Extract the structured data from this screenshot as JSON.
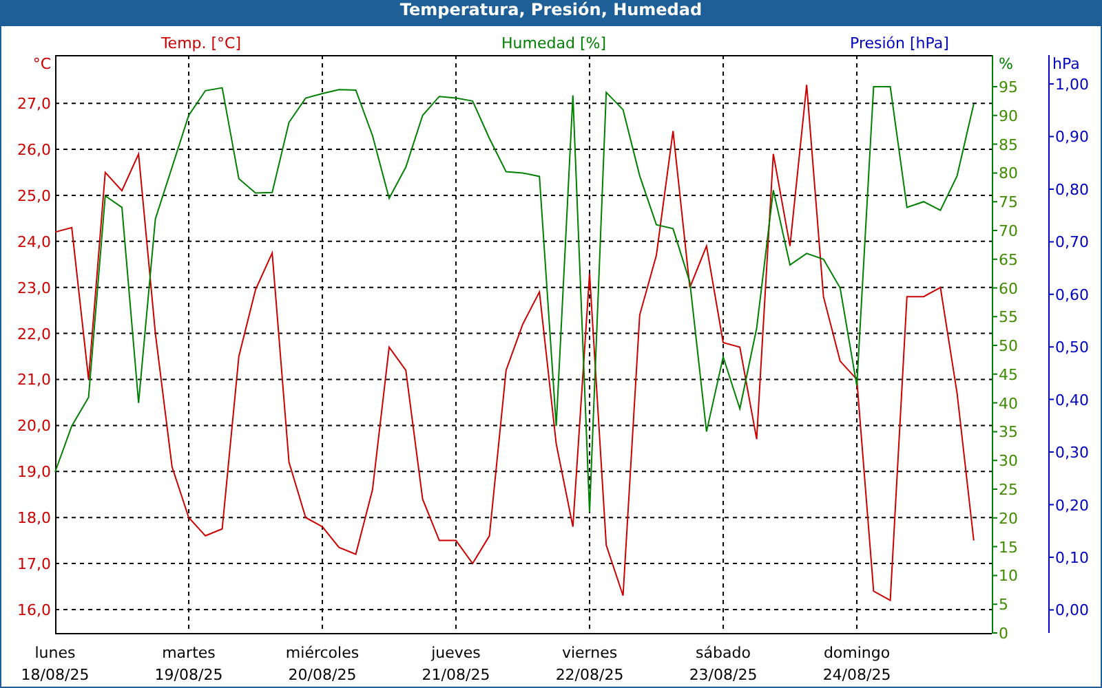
{
  "window": {
    "title": "Temperatura, Presión, Humedad"
  },
  "chart_data": {
    "type": "line",
    "grid": true,
    "categories": [
      "lunes\n18/08/25",
      null,
      null,
      null,
      null,
      null,
      null,
      null,
      "martes\n19/08/25",
      null,
      null,
      null,
      null,
      null,
      null,
      null,
      "miércoles\n20/08/25",
      null,
      null,
      null,
      null,
      null,
      null,
      null,
      "jueves\n21/08/25",
      null,
      null,
      null,
      null,
      null,
      null,
      null,
      "viernes\n22/08/25",
      null,
      null,
      null,
      null,
      null,
      null,
      null,
      "sábado\n23/08/25",
      null,
      null,
      null,
      null,
      null,
      null,
      null,
      "domingo\n24/08/25",
      null,
      null,
      null,
      null,
      null,
      null,
      null
    ],
    "ylabel": "°C",
    "ylim": [
      15.49,
      28.05
    ],
    "yticks": [
      {
        "value": 16,
        "label": "16,0"
      },
      {
        "value": 17,
        "label": "17,0"
      },
      {
        "value": 18,
        "label": "18,0"
      },
      {
        "value": 19,
        "label": "19,0"
      },
      {
        "value": 20,
        "label": "20,0"
      },
      {
        "value": 21,
        "label": "21,0"
      },
      {
        "value": 22,
        "label": "22,0"
      },
      {
        "value": 23,
        "label": "23,0"
      },
      {
        "value": 24,
        "label": "24,0"
      },
      {
        "value": 25,
        "label": "25,0"
      },
      {
        "value": 26,
        "label": "26,0"
      },
      {
        "value": 27,
        "label": "27,0"
      }
    ],
    "y2label": "%",
    "y2lim": [
      0,
      100.5
    ],
    "y2ticks": [
      0,
      5,
      10,
      15,
      20,
      25,
      30,
      35,
      40,
      45,
      50,
      55,
      60,
      65,
      70,
      75,
      80,
      85,
      90,
      95
    ],
    "y3label": "hPa",
    "y3lim": [
      -0.044,
      1.055
    ],
    "y3ticks": [
      {
        "value": 0,
        "label": "0,00"
      },
      {
        "value": 0.1,
        "label": "0,10"
      },
      {
        "value": 0.2,
        "label": "0,20"
      },
      {
        "value": 0.3,
        "label": "0,30"
      },
      {
        "value": 0.4,
        "label": "0,40"
      },
      {
        "value": 0.5,
        "label": "0,50"
      },
      {
        "value": 0.6,
        "label": "0,60"
      },
      {
        "value": 0.7,
        "label": "0,70"
      },
      {
        "value": 0.8,
        "label": "0,80"
      },
      {
        "value": 0.9,
        "label": "0,90"
      },
      {
        "value": 1,
        "label": "1,00"
      }
    ],
    "series": [
      {
        "name": "Temp. [°C]",
        "color": "#cc0000",
        "axis": "y",
        "values": [
          24.2,
          24.3,
          21,
          25.5,
          25.1,
          25.9,
          22,
          19.1,
          18.0,
          17.6,
          17.75,
          21.5,
          22.95,
          23.75,
          19.2,
          18.0,
          17.8,
          17.35,
          17.2,
          18.6,
          21.7,
          21.2,
          18.4,
          17.5,
          17.5,
          17.0,
          17.6,
          21.2,
          22.2,
          22.9,
          19.6,
          17.8,
          23.3,
          17.4,
          16.3,
          22.4,
          23.7,
          26.4,
          23.0,
          23.9,
          21.8,
          21.7,
          19.7,
          25.9,
          23.9,
          27.4,
          22.8,
          21.4,
          21.0,
          16.4,
          16.2,
          22.8,
          22.8,
          23.0,
          20.7,
          17.5
        ]
      },
      {
        "name": "Humedad [%]",
        "color": "#008000",
        "axis": "y2",
        "values": [
          28,
          36,
          41,
          76,
          74,
          40,
          72,
          81,
          90,
          94.3,
          94.8,
          79,
          76.5,
          76.6,
          88.8,
          93,
          93.8,
          94.5,
          94.4,
          86.5,
          75.6,
          81,
          90,
          93.3,
          93,
          92.5,
          86,
          80.2,
          80,
          79.4,
          36,
          93.5,
          21,
          94,
          91,
          79.5,
          71,
          70.3,
          61,
          35,
          48,
          39,
          53,
          77,
          64,
          66,
          65,
          60,
          43,
          95,
          95,
          74,
          75,
          73.5,
          79.5,
          92
        ]
      },
      {
        "name": "Presión [hPa]",
        "color": "#0000c0",
        "axis": "y3",
        "values": [
          null,
          null,
          null,
          null,
          null,
          null,
          null,
          null,
          null,
          null,
          null,
          null,
          null,
          null,
          null,
          null,
          null,
          null,
          null,
          null,
          null,
          null,
          null,
          null,
          null,
          null,
          null,
          null,
          null,
          null,
          null,
          null,
          null,
          null,
          null,
          null,
          null,
          null,
          null,
          null,
          null,
          null,
          null,
          null,
          null,
          null,
          null,
          null,
          null,
          null,
          null,
          null,
          null,
          null,
          null,
          null
        ]
      }
    ]
  }
}
